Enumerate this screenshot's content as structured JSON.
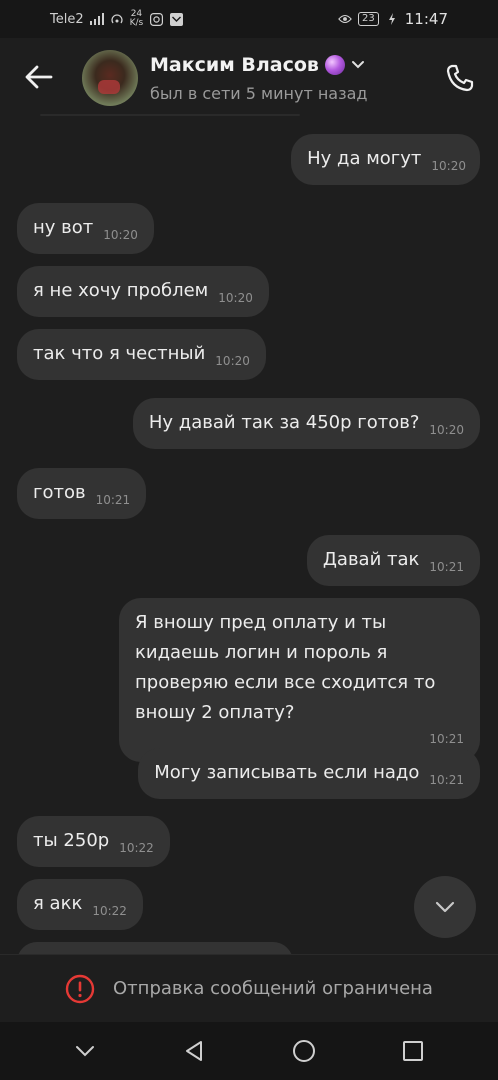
{
  "status_bar": {
    "carrier": "Tele2",
    "net_speed_value": "24",
    "net_speed_unit": "K/s",
    "battery": "23",
    "time": "11:47"
  },
  "header": {
    "contact_name": "Максим Власов",
    "contact_status": "был в сети 5 минут назад"
  },
  "messages": [
    {
      "text": "Ну да могут",
      "time": "10:20",
      "side": "out"
    },
    {
      "text": "ну вот",
      "time": "10:20",
      "side": "in"
    },
    {
      "text": "я не хочу проблем",
      "time": "10:20",
      "side": "in"
    },
    {
      "text": "так что я честный",
      "time": "10:20",
      "side": "in"
    },
    {
      "text": "Ну давай так за 450р готов?",
      "time": "10:20",
      "side": "out"
    },
    {
      "text": "готов",
      "time": "10:21",
      "side": "in"
    },
    {
      "text": "Давай так",
      "time": "10:21",
      "side": "out"
    },
    {
      "text": "Я вношу пред оплату и ты кидаешь логин и пороль я проверяю если все сходится то вношу 2 оплату?",
      "time": "10:21",
      "side": "out"
    },
    {
      "text": "Могу записывать если надо",
      "time": "10:21",
      "side": "out"
    },
    {
      "text": "ты 250р",
      "time": "10:22",
      "side": "in"
    },
    {
      "text": "я акк",
      "time": "10:22",
      "side": "in"
    }
  ],
  "restricted_notice": "Отправка сообщений ограничена",
  "colors": {
    "background": "#1e1e1e",
    "bubble": "#333333",
    "warning": "#e53935"
  }
}
